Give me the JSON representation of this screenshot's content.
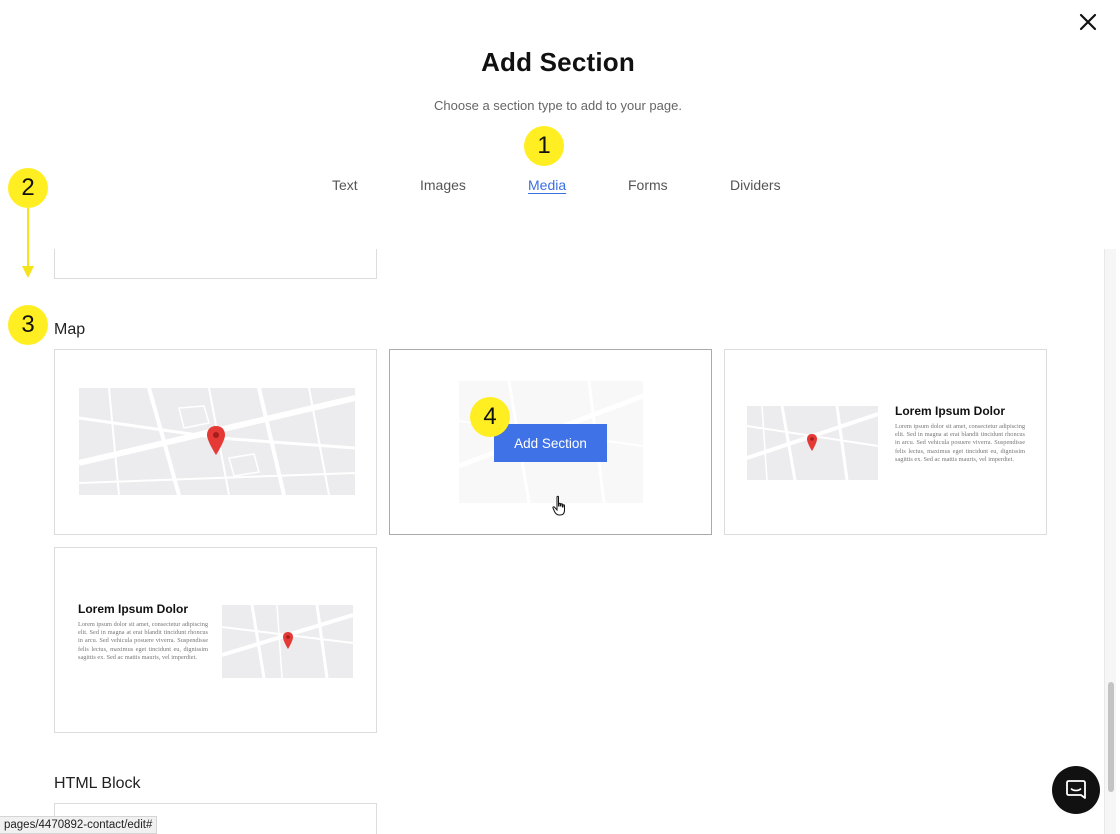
{
  "modal": {
    "title": "Add Section",
    "subtitle": "Choose a section type to add to your page.",
    "close_icon": "close-icon"
  },
  "tabs": [
    {
      "label": "Text"
    },
    {
      "label": "Images"
    },
    {
      "label": "Media",
      "active": true
    },
    {
      "label": "Forms"
    },
    {
      "label": "Dividers"
    }
  ],
  "annotations": {
    "badge_1": "1",
    "badge_2": "2",
    "badge_3": "3",
    "badge_4": "4",
    "color": "#ffee22"
  },
  "sections": {
    "map": {
      "label": "Map",
      "add_button_label": "Add Section",
      "lorem_title": "Lorem Ipsum Dolor",
      "lorem_body": "Lorem ipsum dolor sit amet, consectetur adipiscing elit. Sed in magna at erat blandit tincidunt rhoncus in arcu. Sed vehicula posuere viverra. Suspendisse felis lectus, maximus eget tincidunt eu, dignissim sagittis ex. Sed ac mattis mauris, vel imperdiet."
    },
    "html_block": {
      "label": "HTML Block"
    }
  },
  "status_bar": {
    "url": "pages/4470892-contact/edit#"
  },
  "colors": {
    "accent": "#3f72e6",
    "tab_active": "#3b6fe0",
    "pin": "#e53935",
    "map_bg": "#ececee"
  },
  "icons": {
    "map_pin": "map-pin-icon",
    "chat": "chat-icon",
    "cursor": "hand-cursor-icon"
  }
}
